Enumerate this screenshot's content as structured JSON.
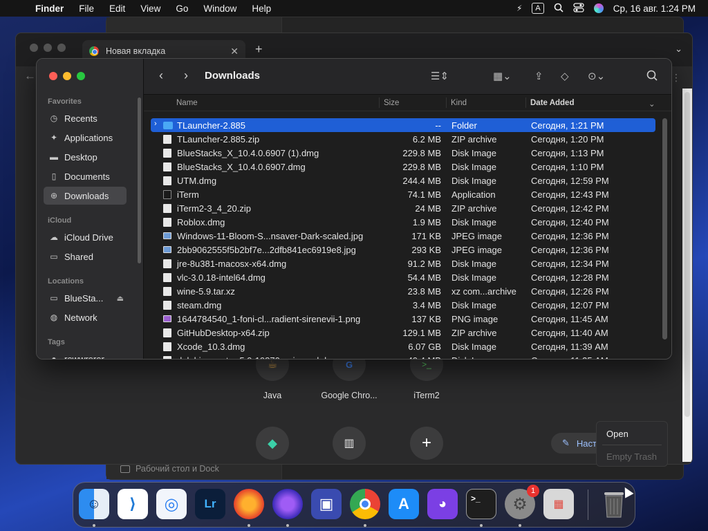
{
  "menubar": {
    "app": "Finder",
    "items": [
      "File",
      "Edit",
      "View",
      "Go",
      "Window",
      "Help"
    ],
    "input_source": "A",
    "clock": "Ср, 16 авг.  1:24 PM"
  },
  "background_window": {
    "footer_label": "Рабочий стол и Dock"
  },
  "chrome": {
    "tab_title": "Новая вкладка",
    "shortcuts": [
      {
        "label": "Java"
      },
      {
        "label": "Google Chro..."
      },
      {
        "label": "iTerm2"
      }
    ],
    "customize_label": "Наст"
  },
  "finder": {
    "title": "Downloads",
    "sidebar": {
      "favorites_header": "Favorites",
      "favorites": [
        "Recents",
        "Applications",
        "Desktop",
        "Documents",
        "Downloads"
      ],
      "icloud_header": "iCloud",
      "icloud": [
        "iCloud Drive",
        "Shared"
      ],
      "locations_header": "Locations",
      "locations": [
        "BlueSta...",
        "Network"
      ],
      "tags_header": "Tags",
      "tags": [
        "rewwrerer"
      ]
    },
    "columns": {
      "name": "Name",
      "size": "Size",
      "kind": "Kind",
      "date": "Date Added"
    },
    "files": [
      {
        "name": "TLauncher-2.885",
        "size": "--",
        "kind": "Folder",
        "date": "Сегодня, 1:21 PM",
        "icon": "folder"
      },
      {
        "name": "TLauncher-2.885.zip",
        "size": "6.2 MB",
        "kind": "ZIP archive",
        "date": "Сегодня, 1:20 PM",
        "icon": "doc"
      },
      {
        "name": "BlueStacks_X_10.4.0.6907 (1).dmg",
        "size": "229.8 MB",
        "kind": "Disk Image",
        "date": "Сегодня, 1:13 PM",
        "icon": "doc"
      },
      {
        "name": "BlueStacks_X_10.4.0.6907.dmg",
        "size": "229.8 MB",
        "kind": "Disk Image",
        "date": "Сегодня, 1:10 PM",
        "icon": "doc"
      },
      {
        "name": "UTM.dmg",
        "size": "244.4 MB",
        "kind": "Disk Image",
        "date": "Сегодня, 12:59 PM",
        "icon": "doc"
      },
      {
        "name": "iTerm",
        "size": "74.1 MB",
        "kind": "Application",
        "date": "Сегодня, 12:43 PM",
        "icon": "app"
      },
      {
        "name": "iTerm2-3_4_20.zip",
        "size": "24 MB",
        "kind": "ZIP archive",
        "date": "Сегодня, 12:42 PM",
        "icon": "doc"
      },
      {
        "name": "Roblox.dmg",
        "size": "1.9 MB",
        "kind": "Disk Image",
        "date": "Сегодня, 12:40 PM",
        "icon": "doc"
      },
      {
        "name": "Windows-11-Bloom-S...nsaver-Dark-scaled.jpg",
        "size": "171 KB",
        "kind": "JPEG image",
        "date": "Сегодня, 12:36 PM",
        "icon": "img"
      },
      {
        "name": "2bb9062555f5b2bf7e...2dfb841ec6919e8.jpg",
        "size": "293 KB",
        "kind": "JPEG image",
        "date": "Сегодня, 12:36 PM",
        "icon": "img"
      },
      {
        "name": "jre-8u381-macosx-x64.dmg",
        "size": "91.2 MB",
        "kind": "Disk Image",
        "date": "Сегодня, 12:34 PM",
        "icon": "doc"
      },
      {
        "name": "vlc-3.0.18-intel64.dmg",
        "size": "54.4 MB",
        "kind": "Disk Image",
        "date": "Сегодня, 12:28 PM",
        "icon": "doc"
      },
      {
        "name": "wine-5.9.tar.xz",
        "size": "23.8 MB",
        "kind": "xz com...archive",
        "date": "Сегодня, 12:26 PM",
        "icon": "doc"
      },
      {
        "name": "steam.dmg",
        "size": "3.4 MB",
        "kind": "Disk Image",
        "date": "Сегодня, 12:07 PM",
        "icon": "doc"
      },
      {
        "name": "1644784540_1-foni-cl...radient-sirenevii-1.png",
        "size": "137 KB",
        "kind": "PNG image",
        "date": "Сегодня, 11:45 AM",
        "icon": "png"
      },
      {
        "name": "GitHubDesktop-x64.zip",
        "size": "129.1 MB",
        "kind": "ZIP archive",
        "date": "Сегодня, 11:40 AM",
        "icon": "doc"
      },
      {
        "name": "Xcode_10.3.dmg",
        "size": "6.07 GB",
        "kind": "Disk Image",
        "date": "Сегодня, 11:39 AM",
        "icon": "doc"
      },
      {
        "name": "dolphin-master-5.0-19870-universal.dmg",
        "size": "40.4 MB",
        "kind": "Disk Image",
        "date": "Сегодня, 11:35 AM",
        "icon": "doc"
      }
    ]
  },
  "context_menu": {
    "open": "Open",
    "empty_trash": "Empty Trash"
  },
  "dock": {
    "settings_badge": "1",
    "lr_label": "Lr"
  },
  "colors": {
    "selection": "#1f5fd6",
    "finder_bg": "#1e1e1e",
    "sidebar_bg": "#2c2c2e"
  }
}
